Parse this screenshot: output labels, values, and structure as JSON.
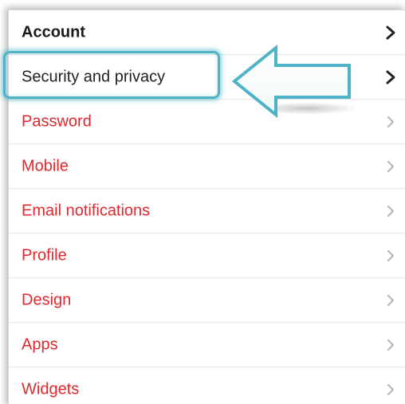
{
  "menu": {
    "header": {
      "label": "Account",
      "icon": "chevron-right-icon"
    },
    "selected": {
      "label": "Security and privacy",
      "icon": "chevron-right-icon"
    },
    "items": [
      {
        "label": "Password",
        "icon": "chevron-right-icon"
      },
      {
        "label": "Mobile",
        "icon": "chevron-right-icon"
      },
      {
        "label": "Email notifications",
        "icon": "chevron-right-icon"
      },
      {
        "label": "Profile",
        "icon": "chevron-right-icon"
      },
      {
        "label": "Design",
        "icon": "chevron-right-icon"
      },
      {
        "label": "Apps",
        "icon": "chevron-right-icon"
      },
      {
        "label": "Widgets",
        "icon": "chevron-right-icon"
      }
    ]
  },
  "annotation": {
    "highlight_color": "#4fb3c8",
    "arrow_icon": "left-arrow-icon"
  },
  "colors": {
    "header_text": "#1a1a1a",
    "selected_text": "#222222",
    "item_text": "#e0282e",
    "chevron_dark": "#222222",
    "chevron_light": "#b5b5b5"
  }
}
